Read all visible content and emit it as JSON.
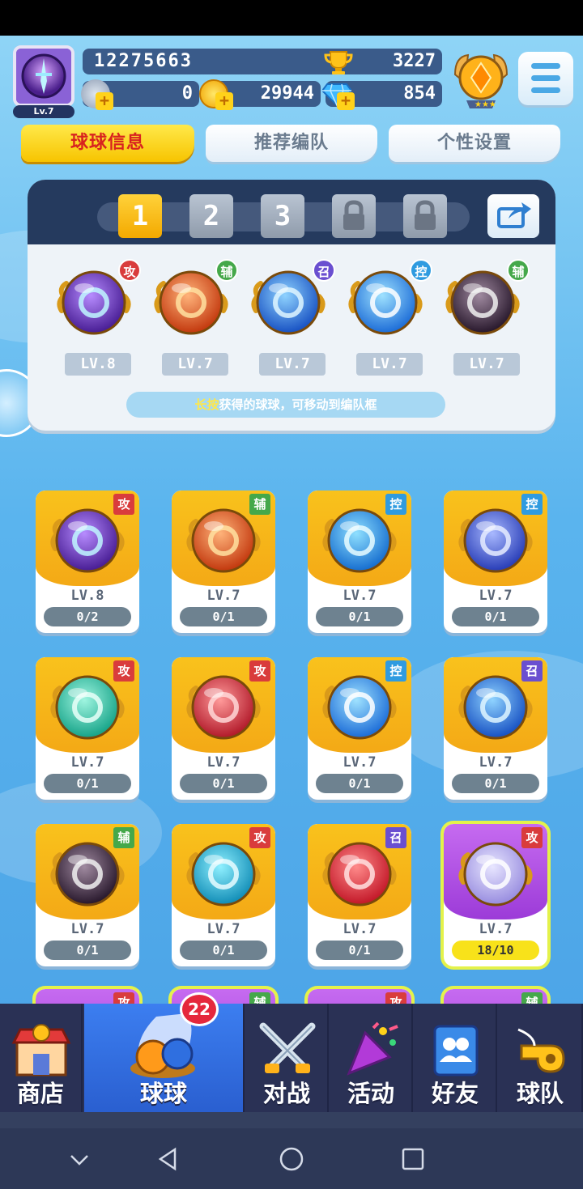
{
  "player": {
    "level": "Lv.7",
    "score": "12275663",
    "trophies": "3227",
    "stamina": "0",
    "coins": "29944",
    "diamonds": "854"
  },
  "tabs": [
    {
      "label": "球球信息",
      "active": true
    },
    {
      "label": "推荐编队",
      "active": false
    },
    {
      "label": "个性设置",
      "active": false
    }
  ],
  "team": {
    "slots": [
      "1",
      "2",
      "3"
    ],
    "members": [
      {
        "type": "攻",
        "level": "LV.8",
        "icon": "sword-orb"
      },
      {
        "type": "辅",
        "level": "LV.7",
        "icon": "phoenix-orb"
      },
      {
        "type": "召",
        "level": "LV.7",
        "icon": "castle-orb"
      },
      {
        "type": "控",
        "level": "LV.7",
        "icon": "snowflake-orb"
      },
      {
        "type": "辅",
        "level": "LV.7",
        "icon": "skull-orb"
      }
    ],
    "hint_highlight": "长按",
    "hint_rest": "获得的球球，可移动到编队框"
  },
  "cards": [
    {
      "type": "攻",
      "level": "LV.8",
      "progress": "0/2",
      "icon": "sword-orb"
    },
    {
      "type": "辅",
      "level": "LV.7",
      "progress": "0/1",
      "icon": "phoenix-orb"
    },
    {
      "type": "控",
      "level": "LV.7",
      "progress": "0/1",
      "icon": "wave-orb"
    },
    {
      "type": "控",
      "level": "LV.7",
      "progress": "0/1",
      "icon": "clock-orb"
    },
    {
      "type": "攻",
      "level": "LV.7",
      "progress": "0/1",
      "icon": "tornado-orb"
    },
    {
      "type": "攻",
      "level": "LV.7",
      "progress": "0/1",
      "icon": "fist-orb"
    },
    {
      "type": "控",
      "level": "LV.7",
      "progress": "0/1",
      "icon": "snowflake-orb"
    },
    {
      "type": "召",
      "level": "LV.7",
      "progress": "0/1",
      "icon": "castle-orb"
    },
    {
      "type": "辅",
      "level": "LV.7",
      "progress": "0/1",
      "icon": "skull-orb"
    },
    {
      "type": "攻",
      "level": "LV.7",
      "progress": "0/1",
      "icon": "arrow-orb"
    },
    {
      "type": "召",
      "level": "LV.7",
      "progress": "0/1",
      "icon": "cannon-orb"
    },
    {
      "type": "攻",
      "level": "LV.7",
      "progress": "18/10",
      "icon": "bubble-orb"
    }
  ],
  "peek_cards": [
    "攻",
    "辅",
    "攻",
    "辅"
  ],
  "nav": [
    {
      "label": "商店",
      "icon": "shop-icon"
    },
    {
      "label": "球球",
      "icon": "balls-icon",
      "badge": "22",
      "active": true
    },
    {
      "label": "对战",
      "icon": "swords-icon"
    },
    {
      "label": "活动",
      "icon": "party-popper-icon"
    },
    {
      "label": "好友",
      "icon": "friends-book-icon"
    },
    {
      "label": "球队",
      "icon": "whistle-icon"
    }
  ],
  "colors": {
    "attack": "#d93c3c",
    "support": "#45a84a",
    "control": "#2f9be0",
    "summon": "#6a4fd0",
    "active_tab": "#f7c400"
  }
}
